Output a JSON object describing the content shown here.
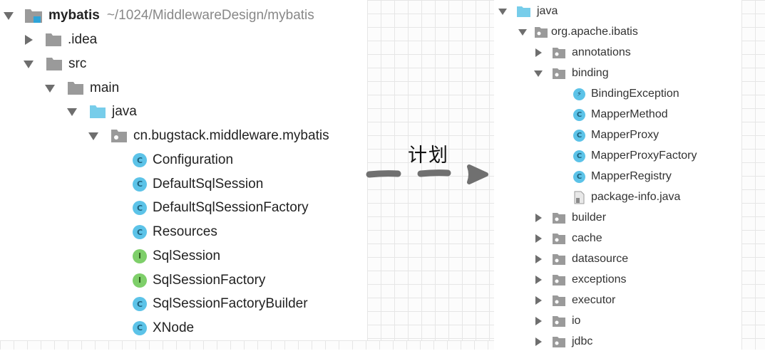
{
  "left_tree": {
    "root": {
      "name": "mybatis",
      "path": "~/1024/MiddlewareDesign/mybatis"
    },
    "idea": ".idea",
    "src": "src",
    "main": "main",
    "java": "java",
    "package": "cn.bugstack.middleware.mybatis",
    "classes": [
      {
        "name": "Configuration",
        "kind": "C"
      },
      {
        "name": "DefaultSqlSession",
        "kind": "C"
      },
      {
        "name": "DefaultSqlSessionFactory",
        "kind": "C"
      },
      {
        "name": "Resources",
        "kind": "C"
      },
      {
        "name": "SqlSession",
        "kind": "I"
      },
      {
        "name": "SqlSessionFactory",
        "kind": "I"
      },
      {
        "name": "SqlSessionFactoryBuilder",
        "kind": "C"
      },
      {
        "name": "XNode",
        "kind": "C"
      }
    ]
  },
  "arrow": {
    "label": "计划"
  },
  "right_tree": {
    "java": "java",
    "package": "org.apache.ibatis",
    "annotations": "annotations",
    "binding": "binding",
    "binding_items": [
      {
        "name": "BindingException",
        "kind": "exception"
      },
      {
        "name": "MapperMethod",
        "kind": "C"
      },
      {
        "name": "MapperProxy",
        "kind": "C"
      },
      {
        "name": "MapperProxyFactory",
        "kind": "C"
      },
      {
        "name": "MapperRegistry",
        "kind": "C"
      },
      {
        "name": "package-info.java",
        "kind": "file"
      }
    ],
    "folders": [
      "builder",
      "cache",
      "datasource",
      "exceptions",
      "executor",
      "io",
      "jdbc"
    ]
  },
  "colors": {
    "folder_gray": "#9a9a9a",
    "folder_blue": "#77cdea",
    "class_badge": "#5cc3e8",
    "interface_badge": "#7ecf6a",
    "arrow": "#707070"
  }
}
